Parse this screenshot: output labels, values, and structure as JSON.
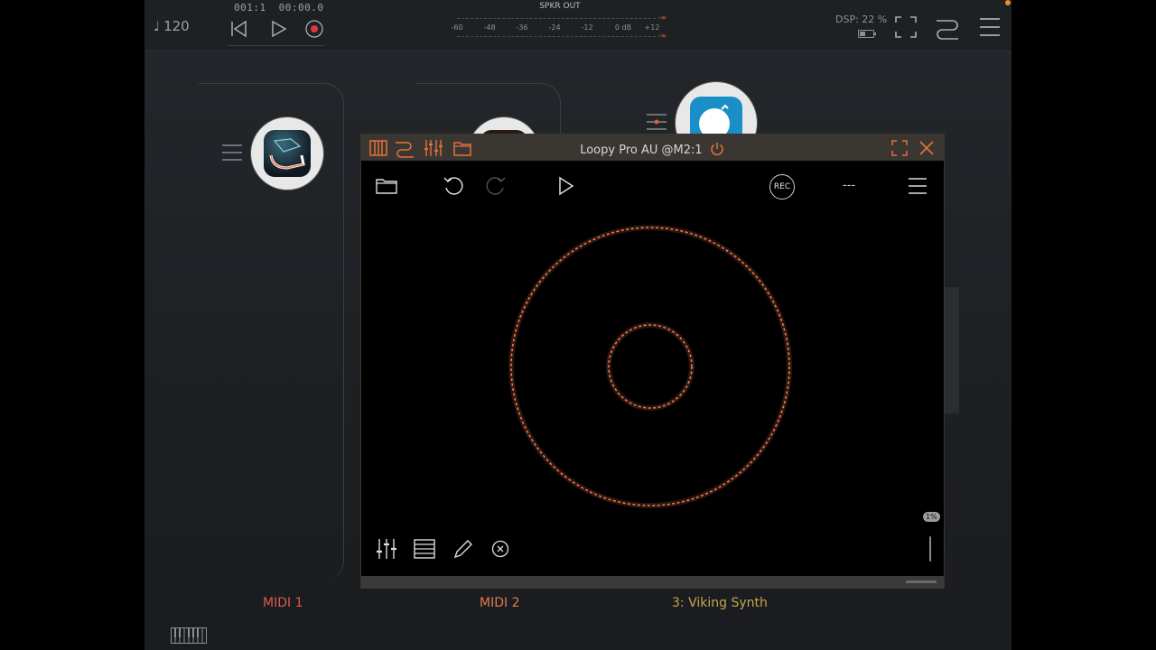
{
  "topbar": {
    "tempo": "120",
    "position_bars": "001:1",
    "position_time": "00:00.0",
    "meter_title": "SPKR OUT",
    "meter_ticks": [
      "-60",
      "-48",
      "-36",
      "-24",
      "-12",
      "0 dB",
      "+12"
    ],
    "meter_peak_top": "-∞",
    "meter_peak_bottom": "-∞",
    "dsp": "DSP: 22 %"
  },
  "tracks": [
    {
      "label": "MIDI 1",
      "color": "#e05a4a"
    },
    {
      "label": "MIDI 2",
      "color": "#e07a4a"
    },
    {
      "label": "3: Viking Synth",
      "color": "#c7a64a"
    }
  ],
  "au_window": {
    "title": "Loopy Pro AU @M2:1",
    "rec_label": "REC",
    "status_dashes": "---",
    "percent_badge": "1%"
  },
  "colors": {
    "accent": "#e8703a",
    "ring": "#f07a52"
  },
  "icons": {
    "topbar": [
      "note-icon",
      "rewind-icon",
      "play-icon",
      "record-icon",
      "fullscreen-icon",
      "routing-icon",
      "menu-icon"
    ],
    "au_titlebar": [
      "keyboard-icon",
      "routing-icon",
      "mixer-icon",
      "folder-icon",
      "power-icon",
      "fullscreen-icon",
      "close-icon"
    ],
    "au_toolbar": [
      "folder-icon",
      "undo-icon",
      "redo-icon",
      "play-icon",
      "rec-button",
      "menu-icon"
    ],
    "au_bottom_tools": [
      "sliders-icon",
      "list-icon",
      "pencil-icon",
      "clear-icon"
    ]
  }
}
